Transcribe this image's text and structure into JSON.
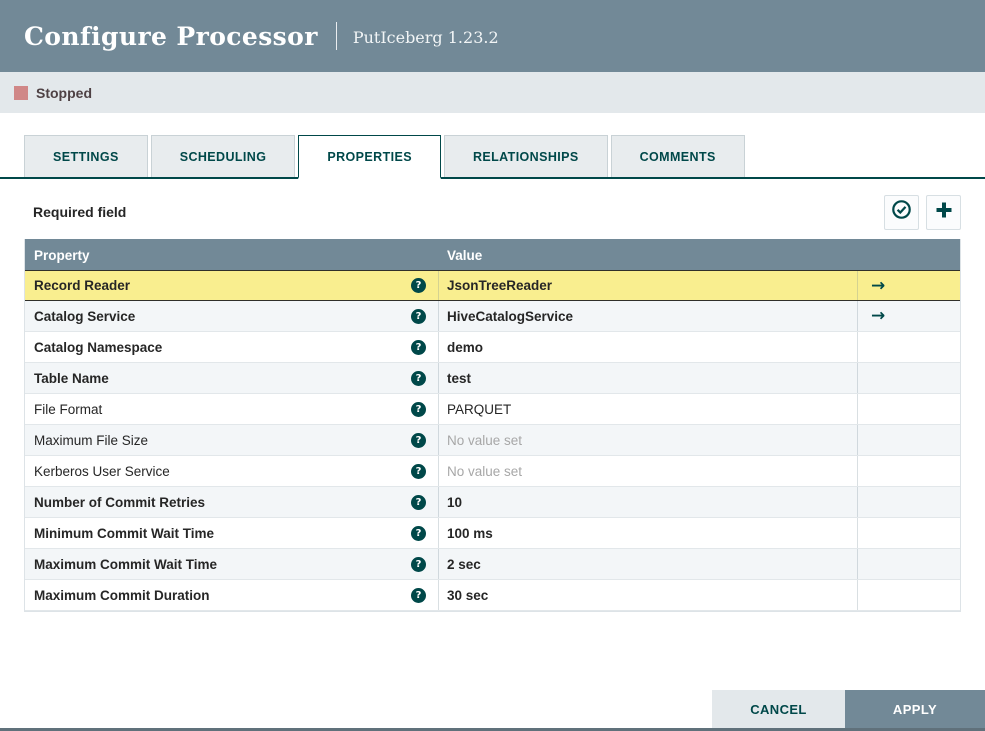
{
  "header": {
    "title": "Configure Processor",
    "subtitle": "PutIceberg 1.23.2"
  },
  "status": {
    "label": "Stopped",
    "indicator_color": "#D08787"
  },
  "tabs": [
    {
      "label": "SETTINGS",
      "active": false
    },
    {
      "label": "SCHEDULING",
      "active": false
    },
    {
      "label": "PROPERTIES",
      "active": true
    },
    {
      "label": "RELATIONSHIPS",
      "active": false
    },
    {
      "label": "COMMENTS",
      "active": false
    }
  ],
  "properties_panel": {
    "required_field_label": "Required field",
    "verify_button_icon": "check-circle-icon",
    "add_button_icon": "plus-icon"
  },
  "table": {
    "columns": {
      "property": "Property",
      "value": "Value"
    },
    "rows": [
      {
        "property": "Record Reader",
        "value": "JsonTreeReader",
        "required": true,
        "selected": true,
        "has_link": true,
        "placeholder": false
      },
      {
        "property": "Catalog Service",
        "value": "HiveCatalogService",
        "required": true,
        "selected": false,
        "has_link": true,
        "placeholder": false
      },
      {
        "property": "Catalog Namespace",
        "value": "demo",
        "required": true,
        "selected": false,
        "has_link": false,
        "placeholder": false
      },
      {
        "property": "Table Name",
        "value": "test",
        "required": true,
        "selected": false,
        "has_link": false,
        "placeholder": false
      },
      {
        "property": "File Format",
        "value": "PARQUET",
        "required": false,
        "selected": false,
        "has_link": false,
        "placeholder": false
      },
      {
        "property": "Maximum File Size",
        "value": "No value set",
        "required": false,
        "selected": false,
        "has_link": false,
        "placeholder": true
      },
      {
        "property": "Kerberos User Service",
        "value": "No value set",
        "required": false,
        "selected": false,
        "has_link": false,
        "placeholder": true
      },
      {
        "property": "Number of Commit Retries",
        "value": "10",
        "required": true,
        "selected": false,
        "has_link": false,
        "placeholder": false
      },
      {
        "property": "Minimum Commit Wait Time",
        "value": "100 ms",
        "required": true,
        "selected": false,
        "has_link": false,
        "placeholder": false
      },
      {
        "property": "Maximum Commit Wait Time",
        "value": "2 sec",
        "required": true,
        "selected": false,
        "has_link": false,
        "placeholder": false
      },
      {
        "property": "Maximum Commit Duration",
        "value": "30 sec",
        "required": true,
        "selected": false,
        "has_link": false,
        "placeholder": false
      }
    ]
  },
  "footer": {
    "cancel_label": "CANCEL",
    "apply_label": "APPLY"
  },
  "colors": {
    "accent_teal": "#004849",
    "header_bg": "#728997",
    "status_bar_bg": "#E3E8EB",
    "selected_row_bg": "#F9EE8F",
    "striped_row_bg": "#F3F6F8",
    "stopped_red": "#D08787"
  }
}
